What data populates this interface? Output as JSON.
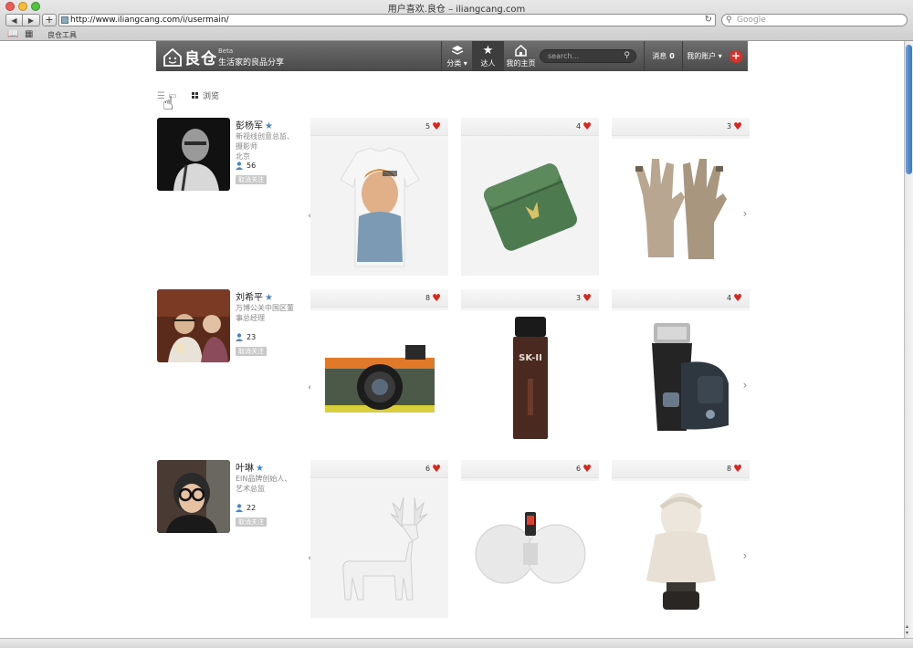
{
  "browser": {
    "window_title": "用户喜欢.良仓 – iliangcang.com",
    "url": "http://www.iliangcang.com/i/usermain/",
    "search_placeholder": "Google",
    "bookmark": "良仓工具"
  },
  "header": {
    "logo_text": "良仓",
    "beta": "Beta",
    "tagline": "生活家的良品分享",
    "nav": [
      {
        "label": "分类",
        "icon": "layers-icon",
        "has_dropdown": true
      },
      {
        "label": "达人",
        "icon": "star-icon",
        "active": true
      },
      {
        "label": "我的主页",
        "icon": "home-icon"
      }
    ],
    "search_placeholder": "search...",
    "messages_label": "消息",
    "messages_count": "0",
    "account_label": "我的账户",
    "add_icon": "plus-icon"
  },
  "view_toggle": {
    "list_icon": "list-icon",
    "grid_label": "浏览"
  },
  "users": [
    {
      "name": "彭杨军",
      "bio": "新视线创意总监、摄影师\n北京",
      "followers": "56",
      "unfollow_label": "取消关注",
      "items": [
        {
          "likes": "5",
          "image": "t-shirt"
        },
        {
          "likes": "4",
          "image": "green-lighter"
        },
        {
          "likes": "3",
          "image": "knit-gloves"
        }
      ]
    },
    {
      "name": "刘希平",
      "bio": "万博公关中国区董事总经理",
      "followers": "23",
      "unfollow_label": "取消关注",
      "items": [
        {
          "likes": "8",
          "image": "camera"
        },
        {
          "likes": "3",
          "image": "skii-bottle"
        },
        {
          "likes": "4",
          "image": "shaver"
        }
      ]
    },
    {
      "name": "叶琳",
      "bio": "EIN品牌创始人、艺术总监",
      "followers": "22",
      "unfollow_label": "取消关注",
      "items": [
        {
          "likes": "6",
          "image": "white-deer"
        },
        {
          "likes": "6",
          "image": "speaker-dock"
        },
        {
          "likes": "8",
          "image": "veiled-bust"
        }
      ]
    }
  ],
  "colors": {
    "header_bg": "#555555",
    "heart": "#d7281f",
    "star": "#4a86c7",
    "add_button": "#d9302a"
  }
}
